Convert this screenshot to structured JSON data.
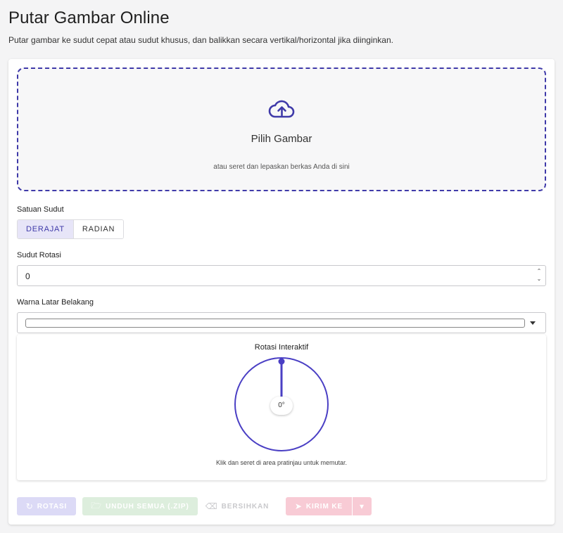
{
  "header": {
    "title": "Putar Gambar Online",
    "subtitle": "Putar gambar ke sudut cepat atau sudut khusus, dan balikkan secara vertikal/horizontal jika diinginkan."
  },
  "dropzone": {
    "icon": "cloud-upload-icon",
    "title": "Pilih Gambar",
    "hint": "atau seret dan lepaskan berkas Anda di sini"
  },
  "angle_unit": {
    "label": "Satuan Sudut",
    "options": [
      "DERAJAT",
      "RADIAN"
    ],
    "selected": "DERAJAT"
  },
  "rotation_angle": {
    "label": "Sudut Rotasi",
    "value": "0"
  },
  "background_color": {
    "label": "Warna Latar Belakang",
    "value": "#ffffff"
  },
  "interactive_rotation": {
    "title": "Rotasi Interaktif",
    "angle_display": "0°",
    "angle_degrees": 0,
    "hint": "Klik dan seret di area pratinjau untuk memutar."
  },
  "actions": {
    "rotate": "ROTASI",
    "download_all": "UNDUH SEMUA (.ZIP)",
    "clear": "BERSIHKAN",
    "send_to": "KIRIM KE"
  },
  "colors": {
    "accent": "#3f3aa9",
    "dial": "#4a3fc4"
  }
}
